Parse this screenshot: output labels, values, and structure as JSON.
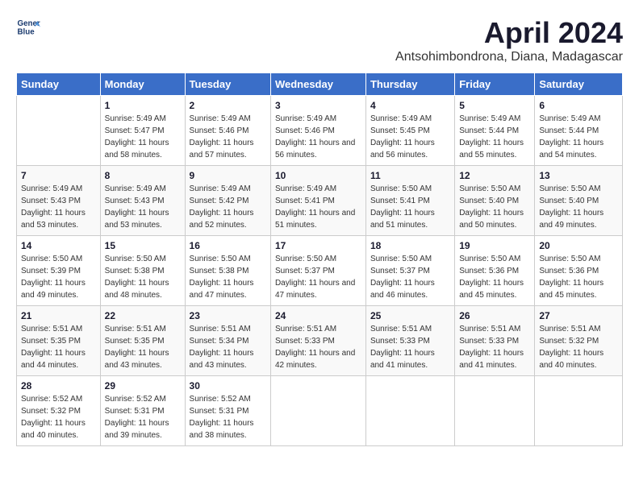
{
  "logo": {
    "line1": "General",
    "line2": "Blue"
  },
  "title": "April 2024",
  "subtitle": "Antsohimbondrona, Diana, Madagascar",
  "days_header": [
    "Sunday",
    "Monday",
    "Tuesday",
    "Wednesday",
    "Thursday",
    "Friday",
    "Saturday"
  ],
  "weeks": [
    [
      {
        "day": "",
        "sunrise": "",
        "sunset": "",
        "daylight": ""
      },
      {
        "day": "1",
        "sunrise": "Sunrise: 5:49 AM",
        "sunset": "Sunset: 5:47 PM",
        "daylight": "Daylight: 11 hours and 58 minutes."
      },
      {
        "day": "2",
        "sunrise": "Sunrise: 5:49 AM",
        "sunset": "Sunset: 5:46 PM",
        "daylight": "Daylight: 11 hours and 57 minutes."
      },
      {
        "day": "3",
        "sunrise": "Sunrise: 5:49 AM",
        "sunset": "Sunset: 5:46 PM",
        "daylight": "Daylight: 11 hours and 56 minutes."
      },
      {
        "day": "4",
        "sunrise": "Sunrise: 5:49 AM",
        "sunset": "Sunset: 5:45 PM",
        "daylight": "Daylight: 11 hours and 56 minutes."
      },
      {
        "day": "5",
        "sunrise": "Sunrise: 5:49 AM",
        "sunset": "Sunset: 5:44 PM",
        "daylight": "Daylight: 11 hours and 55 minutes."
      },
      {
        "day": "6",
        "sunrise": "Sunrise: 5:49 AM",
        "sunset": "Sunset: 5:44 PM",
        "daylight": "Daylight: 11 hours and 54 minutes."
      }
    ],
    [
      {
        "day": "7",
        "sunrise": "Sunrise: 5:49 AM",
        "sunset": "Sunset: 5:43 PM",
        "daylight": "Daylight: 11 hours and 53 minutes."
      },
      {
        "day": "8",
        "sunrise": "Sunrise: 5:49 AM",
        "sunset": "Sunset: 5:43 PM",
        "daylight": "Daylight: 11 hours and 53 minutes."
      },
      {
        "day": "9",
        "sunrise": "Sunrise: 5:49 AM",
        "sunset": "Sunset: 5:42 PM",
        "daylight": "Daylight: 11 hours and 52 minutes."
      },
      {
        "day": "10",
        "sunrise": "Sunrise: 5:49 AM",
        "sunset": "Sunset: 5:41 PM",
        "daylight": "Daylight: 11 hours and 51 minutes."
      },
      {
        "day": "11",
        "sunrise": "Sunrise: 5:50 AM",
        "sunset": "Sunset: 5:41 PM",
        "daylight": "Daylight: 11 hours and 51 minutes."
      },
      {
        "day": "12",
        "sunrise": "Sunrise: 5:50 AM",
        "sunset": "Sunset: 5:40 PM",
        "daylight": "Daylight: 11 hours and 50 minutes."
      },
      {
        "day": "13",
        "sunrise": "Sunrise: 5:50 AM",
        "sunset": "Sunset: 5:40 PM",
        "daylight": "Daylight: 11 hours and 49 minutes."
      }
    ],
    [
      {
        "day": "14",
        "sunrise": "Sunrise: 5:50 AM",
        "sunset": "Sunset: 5:39 PM",
        "daylight": "Daylight: 11 hours and 49 minutes."
      },
      {
        "day": "15",
        "sunrise": "Sunrise: 5:50 AM",
        "sunset": "Sunset: 5:38 PM",
        "daylight": "Daylight: 11 hours and 48 minutes."
      },
      {
        "day": "16",
        "sunrise": "Sunrise: 5:50 AM",
        "sunset": "Sunset: 5:38 PM",
        "daylight": "Daylight: 11 hours and 47 minutes."
      },
      {
        "day": "17",
        "sunrise": "Sunrise: 5:50 AM",
        "sunset": "Sunset: 5:37 PM",
        "daylight": "Daylight: 11 hours and 47 minutes."
      },
      {
        "day": "18",
        "sunrise": "Sunrise: 5:50 AM",
        "sunset": "Sunset: 5:37 PM",
        "daylight": "Daylight: 11 hours and 46 minutes."
      },
      {
        "day": "19",
        "sunrise": "Sunrise: 5:50 AM",
        "sunset": "Sunset: 5:36 PM",
        "daylight": "Daylight: 11 hours and 45 minutes."
      },
      {
        "day": "20",
        "sunrise": "Sunrise: 5:50 AM",
        "sunset": "Sunset: 5:36 PM",
        "daylight": "Daylight: 11 hours and 45 minutes."
      }
    ],
    [
      {
        "day": "21",
        "sunrise": "Sunrise: 5:51 AM",
        "sunset": "Sunset: 5:35 PM",
        "daylight": "Daylight: 11 hours and 44 minutes."
      },
      {
        "day": "22",
        "sunrise": "Sunrise: 5:51 AM",
        "sunset": "Sunset: 5:35 PM",
        "daylight": "Daylight: 11 hours and 43 minutes."
      },
      {
        "day": "23",
        "sunrise": "Sunrise: 5:51 AM",
        "sunset": "Sunset: 5:34 PM",
        "daylight": "Daylight: 11 hours and 43 minutes."
      },
      {
        "day": "24",
        "sunrise": "Sunrise: 5:51 AM",
        "sunset": "Sunset: 5:33 PM",
        "daylight": "Daylight: 11 hours and 42 minutes."
      },
      {
        "day": "25",
        "sunrise": "Sunrise: 5:51 AM",
        "sunset": "Sunset: 5:33 PM",
        "daylight": "Daylight: 11 hours and 41 minutes."
      },
      {
        "day": "26",
        "sunrise": "Sunrise: 5:51 AM",
        "sunset": "Sunset: 5:33 PM",
        "daylight": "Daylight: 11 hours and 41 minutes."
      },
      {
        "day": "27",
        "sunrise": "Sunrise: 5:51 AM",
        "sunset": "Sunset: 5:32 PM",
        "daylight": "Daylight: 11 hours and 40 minutes."
      }
    ],
    [
      {
        "day": "28",
        "sunrise": "Sunrise: 5:52 AM",
        "sunset": "Sunset: 5:32 PM",
        "daylight": "Daylight: 11 hours and 40 minutes."
      },
      {
        "day": "29",
        "sunrise": "Sunrise: 5:52 AM",
        "sunset": "Sunset: 5:31 PM",
        "daylight": "Daylight: 11 hours and 39 minutes."
      },
      {
        "day": "30",
        "sunrise": "Sunrise: 5:52 AM",
        "sunset": "Sunset: 5:31 PM",
        "daylight": "Daylight: 11 hours and 38 minutes."
      },
      {
        "day": "",
        "sunrise": "",
        "sunset": "",
        "daylight": ""
      },
      {
        "day": "",
        "sunrise": "",
        "sunset": "",
        "daylight": ""
      },
      {
        "day": "",
        "sunrise": "",
        "sunset": "",
        "daylight": ""
      },
      {
        "day": "",
        "sunrise": "",
        "sunset": "",
        "daylight": ""
      }
    ]
  ]
}
